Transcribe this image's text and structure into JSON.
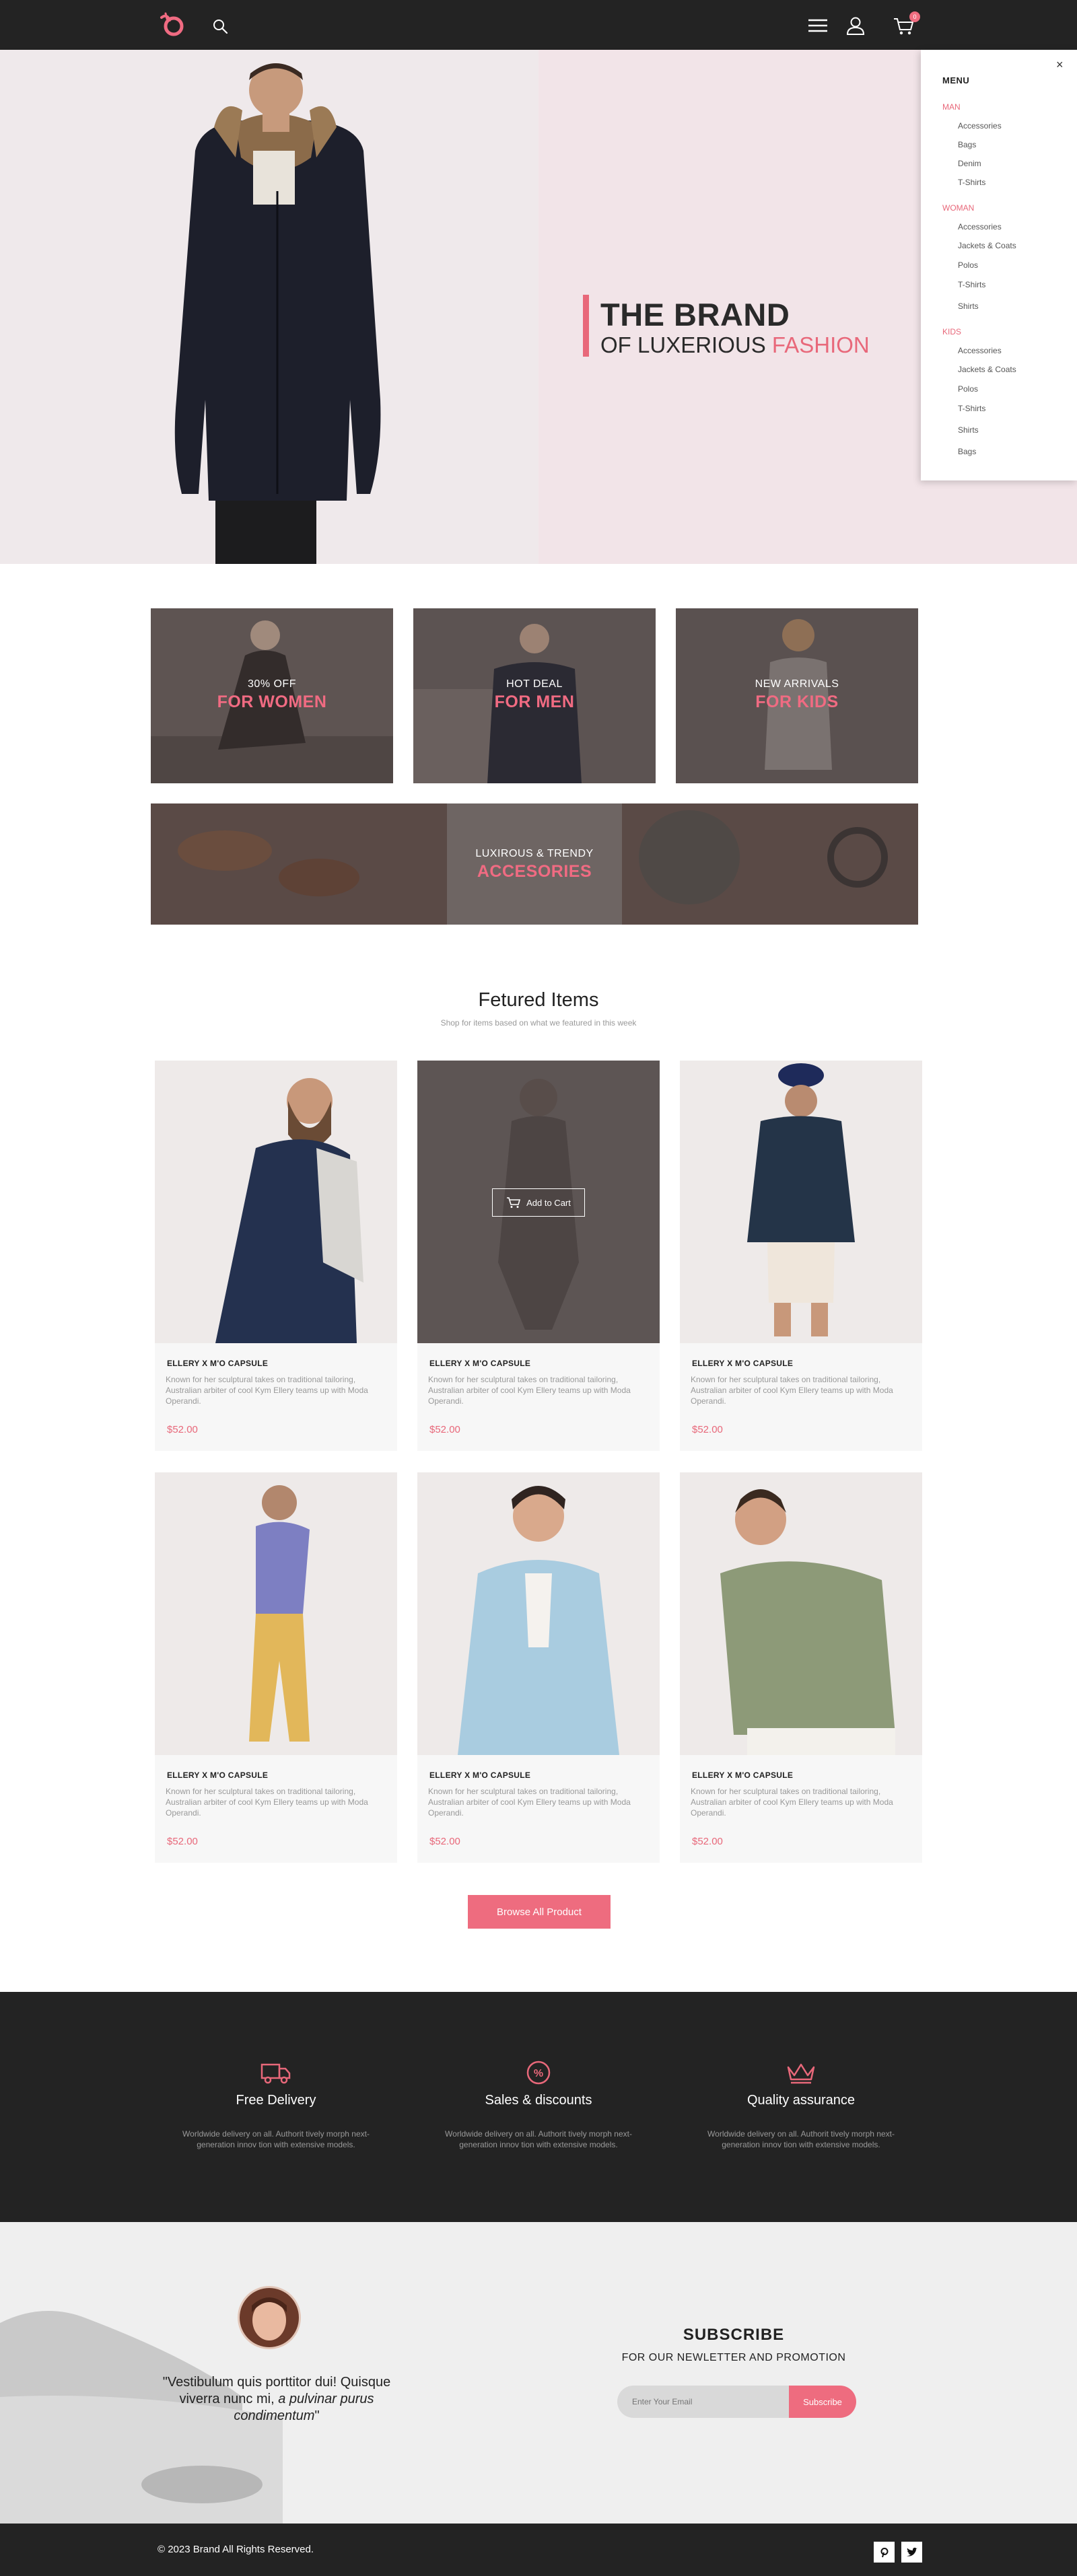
{
  "header": {
    "cart_count": "0"
  },
  "hero": {
    "title": "THE BRAND",
    "subtitle_start": "OF LUXERIOUS",
    "subtitle_accent": "FASHION"
  },
  "menu": {
    "title": "MENU",
    "close": "×",
    "groups": [
      {
        "label": "MAN",
        "items": [
          "Accessories",
          "Bags",
          "Denim",
          "T-Shirts"
        ]
      },
      {
        "label": "WOMAN",
        "items": [
          "Accessories",
          "Jackets & Coats",
          "Polos",
          "T-Shirts",
          "Shirts"
        ]
      },
      {
        "label": "KIDS",
        "items": [
          "Accessories",
          "Jackets & Coats",
          "Polos",
          "T-Shirts",
          "Shirts",
          "Bags"
        ]
      }
    ]
  },
  "categories": [
    {
      "small": "30% OFF",
      "big": "FOR WOMEN"
    },
    {
      "small": "HOT DEAL",
      "big": "FOR MEN"
    },
    {
      "small": "NEW ARRIVALS",
      "big": "FOR KIDS"
    },
    {
      "small": "LUXIROUS & TRENDY",
      "big": "ACCESORIES"
    }
  ],
  "featured": {
    "title": "Fetured Items",
    "subtitle": "Shop for items based on what we featured in this week",
    "add_to_cart": "Add to Cart",
    "products": [
      {
        "name": "ELLERY X M'O CAPSULE",
        "desc": "Known for her sculptural takes on traditional tailoring, Australian arbiter of cool Kym Ellery teams up with Moda Operandi.",
        "price": "$52.00"
      },
      {
        "name": "ELLERY X M'O CAPSULE",
        "desc": "Known for her sculptural takes on traditional tailoring, Australian arbiter of cool Kym Ellery teams up with Moda Operandi.",
        "price": "$52.00"
      },
      {
        "name": "ELLERY X M'O CAPSULE",
        "desc": "Known for her sculptural takes on traditional tailoring, Australian arbiter of cool Kym Ellery teams up with Moda Operandi.",
        "price": "$52.00"
      },
      {
        "name": "ELLERY X M'O CAPSULE",
        "desc": "Known for her sculptural takes on traditional tailoring, Australian arbiter of cool Kym Ellery teams up with Moda Operandi.",
        "price": "$52.00"
      },
      {
        "name": "ELLERY X M'O CAPSULE",
        "desc": "Known for her sculptural takes on traditional tailoring, Australian arbiter of cool Kym Ellery teams up with Moda Operandi.",
        "price": "$52.00"
      },
      {
        "name": "ELLERY X M'O CAPSULE",
        "desc": "Known for her sculptural takes on traditional tailoring, Australian arbiter of cool Kym Ellery teams up with Moda Operandi.",
        "price": "$52.00"
      }
    ],
    "browse_label": "Browse All Product"
  },
  "features": [
    {
      "icon": "truck-icon",
      "title": "Free Delivery",
      "desc": "Worldwide delivery on all. Authorit tively morph next-generation innov tion with extensive models."
    },
    {
      "icon": "percent-badge-icon",
      "title": "Sales & discounts",
      "desc": "Worldwide delivery on all. Authorit tively morph next-generation innov tion with extensive models."
    },
    {
      "icon": "crown-icon",
      "title": "Quality assurance",
      "desc": "Worldwide delivery on all. Authorit tively morph next-generation innov tion with extensive models."
    }
  ],
  "testimonial": {
    "quote_start": "\"Vestibulum quis porttitor dui! Quisque viverra nunc mi,",
    "quote_italic": "a pulvinar purus condimentum",
    "quote_end": "\""
  },
  "newsletter": {
    "title": "SUBSCRIBE",
    "subtitle": "FOR OUR NEWLETTER AND PROMOTION",
    "placeholder": "Enter Your Email",
    "button": "Subscribe"
  },
  "footer": {
    "copyright": "© 2023 Brand  All Rights Reserved.",
    "social": [
      "pinterest-icon",
      "twitter-icon"
    ]
  },
  "colors": {
    "accent": "#e8687a",
    "dark": "#232323"
  }
}
